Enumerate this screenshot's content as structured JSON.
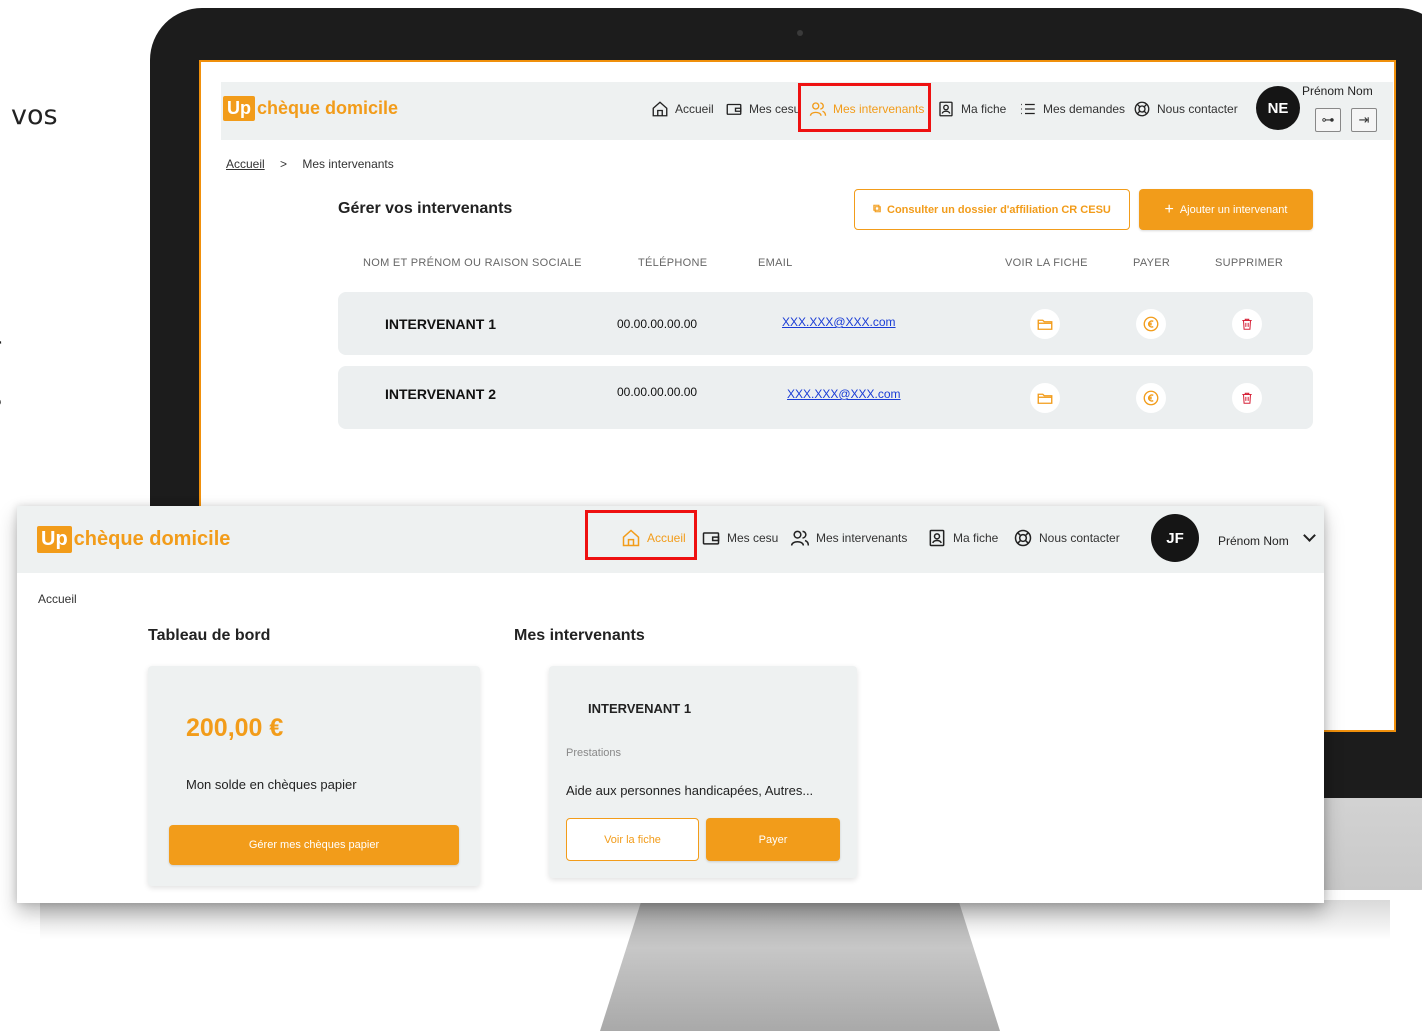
{
  "edge_text": [
    "vos",
    "r",
    "s"
  ],
  "colors": {
    "accent": "#f29c1a",
    "highlight": "#e11111",
    "link": "#1a3cd6",
    "delete": "#d6243a"
  },
  "back": {
    "logo": {
      "up": "Up",
      "brand": "chèque domicile"
    },
    "nav": {
      "accueil": "Accueil",
      "mes_cesu": "Mes cesu",
      "mes_intervenants": "Mes intervenants",
      "ma_fiche": "Ma fiche",
      "mes_demandes": "Mes demandes",
      "nous_contacter": "Nous contacter"
    },
    "user": {
      "initials": "NE",
      "name": "Prénom Nom"
    },
    "breadcrumb": {
      "home": "Accueil",
      "separator": ">",
      "current": "Mes intervenants"
    },
    "section_title": "Gérer vos intervenants",
    "buttons": {
      "consult": "Consulter un dossier d'affiliation CR CESU",
      "add": "Ajouter un intervenant"
    },
    "table": {
      "headers": {
        "name": "NOM ET PRÉNOM OU RAISON SOCIALE",
        "phone": "TÉLÉPHONE",
        "email": "EMAIL",
        "view": "VOIR LA FICHE",
        "pay": "PAYER",
        "delete": "SUPPRIMER"
      },
      "rows": [
        {
          "name": "INTERVENANT 1",
          "phone": "00.00.00.00.00",
          "email": "XXX.XXX@XXX.com"
        },
        {
          "name": "INTERVENANT 2",
          "phone": "00.00.00.00.00",
          "email": "XXX.XXX@XXX.com"
        }
      ]
    }
  },
  "front": {
    "logo": {
      "up": "Up",
      "brand": "chèque domicile"
    },
    "nav": {
      "accueil": "Accueil",
      "mes_cesu": "Mes cesu",
      "mes_intervenants": "Mes intervenants",
      "ma_fiche": "Ma fiche",
      "nous_contacter": "Nous contacter"
    },
    "user": {
      "initials": "JF",
      "name": "Prénom Nom"
    },
    "breadcrumb": "Accueil",
    "dashboard": {
      "title": "Tableau de bord",
      "amount": "200,00 €",
      "balance_label": "Mon solde en chèques papier",
      "button": "Gérer mes chèques papier"
    },
    "intervenants": {
      "title": "Mes intervenants",
      "name": "INTERVENANT 1",
      "prestations_label": "Prestations",
      "prestations": "Aide aux personnes handicapées, Autres...",
      "view_button": "Voir la fiche",
      "pay_button": "Payer"
    }
  }
}
